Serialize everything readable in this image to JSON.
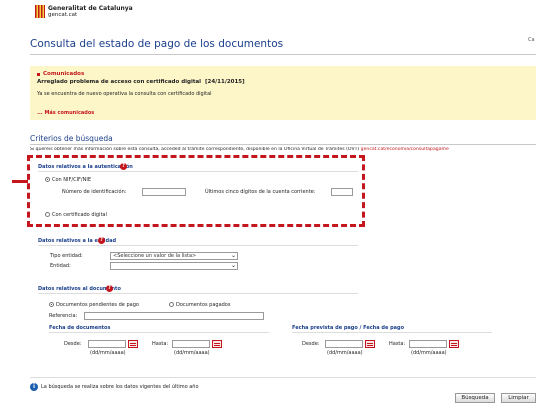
{
  "header": {
    "org_name": "Generalitat de Catalunya",
    "org_site": "gencat.cat",
    "corner_text": "Ca"
  },
  "page": {
    "title": "Consulta del estado de pago de los documentos"
  },
  "news": {
    "heading": "Comunicados",
    "item_title": "Arreglado problema de acceso con certificado digital",
    "item_date": "[24/11/2015]",
    "item_body": "Ya se encuentra de nuevo operativa la consulta con certificado digital",
    "more_link": "... Más comunicados"
  },
  "criteria": {
    "title": "Criterios de búsqueda",
    "intro": "Si queréis obtener más información sobre esta consulta, acceded al trámite correspondiente, disponible en la Oficina Virtual de Trámites (OVT)",
    "intro_link": "gencat.cat/economia/consultapagame"
  },
  "auth": {
    "title": "Datos relativos a la autenticación",
    "option_nif": "Con NIF/CIF/NIE",
    "id_label": "Número de identificación:",
    "account_label": "Últimos cinco dígitos de la cuenta corriente:",
    "option_cert": "Con certificado digital",
    "selected": "Con NIF/CIF/NIE"
  },
  "entity": {
    "title": "Datos relativos a la entidad",
    "type_label": "Tipo entidad:",
    "type_value": "<Seleccione un valor de la lista>",
    "entity_label": "Entidad:",
    "entity_value": ""
  },
  "document": {
    "title": "Datos relativos al documento",
    "option_pending": "Documentos pendientes de pago",
    "option_paid": "Documentos pagados",
    "selected": "Documentos pendientes de pago",
    "reference_label": "Referencia:",
    "doc_dates_title": "Fecha de documentos",
    "pay_dates_title": "Fecha prevista de pago / Fecha de pago",
    "from_label": "Desde:",
    "to_label": "Hasta:",
    "date_format": "(dd/mm/aaaa)"
  },
  "footer": {
    "info_text": "La búsqueda se realiza sobre los datos vigentes del último año",
    "search_button": "Búsqueda",
    "clear_button": "Limpiar"
  },
  "colors": {
    "brand_red": "#c4161c",
    "title_blue": "#1b3f8b",
    "news_bg": "#fdf6c8",
    "highlight_dash": "#c4161c"
  }
}
